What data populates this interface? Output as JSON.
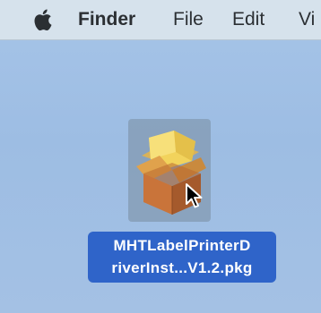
{
  "menubar": {
    "apple_icon": "apple-logo",
    "app_name": "Finder",
    "items": [
      "File",
      "Edit",
      "Vi"
    ]
  },
  "desktop": {
    "background_color": "#9ebde3",
    "selected_file": {
      "icon": "package-box-icon",
      "name_line1": "MHTLabelPrinterD",
      "name_line2": "riverInst...V1.2.pkg",
      "selection_color": "#2f64c9"
    }
  }
}
